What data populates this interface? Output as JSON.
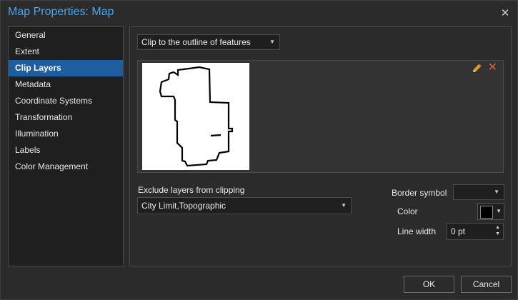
{
  "window": {
    "title": "Map Properties: Map",
    "close_label": "✕"
  },
  "nav": {
    "items": [
      {
        "label": "General"
      },
      {
        "label": "Extent"
      },
      {
        "label": "Clip Layers",
        "active": true
      },
      {
        "label": "Metadata"
      },
      {
        "label": "Coordinate Systems"
      },
      {
        "label": "Transformation"
      },
      {
        "label": "Illumination"
      },
      {
        "label": "Labels"
      },
      {
        "label": "Color Management"
      }
    ]
  },
  "clip": {
    "mode_value": "Clip to the outline of features",
    "edit_icon": "pencil-icon",
    "delete_icon": "delete-x-icon"
  },
  "exclude": {
    "label": "Exclude layers from clipping",
    "value": "City Limit,Topographic"
  },
  "border": {
    "symbol_label": "Border symbol",
    "symbol_value": "",
    "color_label": "Color",
    "color_value": "#000000",
    "line_width_label": "Line width",
    "line_width_value": "0 pt"
  },
  "buttons": {
    "ok": "OK",
    "cancel": "Cancel"
  }
}
